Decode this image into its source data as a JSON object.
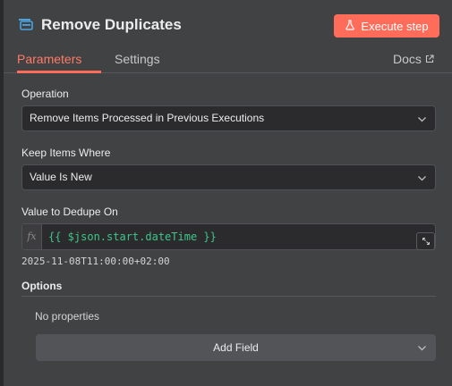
{
  "header": {
    "node_title": "Remove Duplicates",
    "node_icon": "remove-duplicates-icon",
    "execute_label": "Execute step",
    "execute_icon": "flask-icon",
    "tabs": [
      {
        "label": "Parameters",
        "active": true
      },
      {
        "label": "Settings",
        "active": false
      }
    ],
    "docs_label": "Docs",
    "docs_icon": "external-link-icon"
  },
  "params": {
    "operation": {
      "label": "Operation",
      "value": "Remove Items Processed in Previous Executions"
    },
    "keep_items_where": {
      "label": "Keep Items Where",
      "value": "Value Is New"
    },
    "dedupe_value": {
      "label": "Value to Dedupe On",
      "fx_label": "fx",
      "expression": "{{ $json.start.dateTime }}",
      "preview": "2025-11-08T11:00:00+02:00"
    },
    "options": {
      "label": "Options",
      "empty_text": "No properties",
      "add_field_label": "Add Field"
    }
  },
  "colors": {
    "accent": "#ff6d5a",
    "panel_bg": "#414244",
    "input_bg": "#2b2b2d",
    "expression_text": "#3fc58a"
  }
}
